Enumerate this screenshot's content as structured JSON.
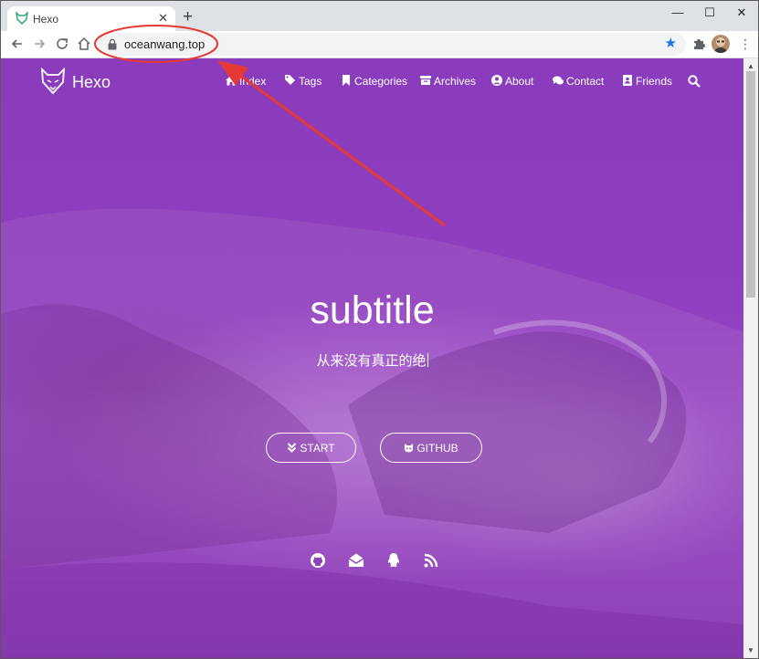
{
  "browser": {
    "tab_title": "Hexo",
    "url": "oceanwang.top",
    "close_glyph": "✕",
    "newtab_glyph": "+",
    "minimize_glyph": "—",
    "maximize_glyph": "☐",
    "window_close_glyph": "✕",
    "star_glyph": "★",
    "menu_glyph": "⋮"
  },
  "site": {
    "name": "Hexo",
    "nav": [
      {
        "label": "Index",
        "icon": "home-icon"
      },
      {
        "label": "Tags",
        "icon": "tags-icon"
      },
      {
        "label": "Categories",
        "icon": "bookmark-icon"
      },
      {
        "label": "Archives",
        "icon": "archive-icon"
      },
      {
        "label": "About",
        "icon": "user-circle-icon"
      },
      {
        "label": "Contact",
        "icon": "comments-icon"
      },
      {
        "label": "Friends",
        "icon": "address-book-icon"
      }
    ]
  },
  "hero": {
    "title": "subtitle",
    "subtitle": "从来没有真正的绝",
    "buttons": [
      {
        "label": "START",
        "icon": "angle-double-down-icon"
      },
      {
        "label": "GITHUB",
        "icon": "github-alt-icon"
      }
    ],
    "social": [
      "github-icon",
      "email-icon",
      "qq-icon",
      "rss-icon"
    ]
  },
  "colors": {
    "hero_purple": "#8a3cbc",
    "annotation_red": "#e53935",
    "bookmark_star": "#1a73e8"
  }
}
